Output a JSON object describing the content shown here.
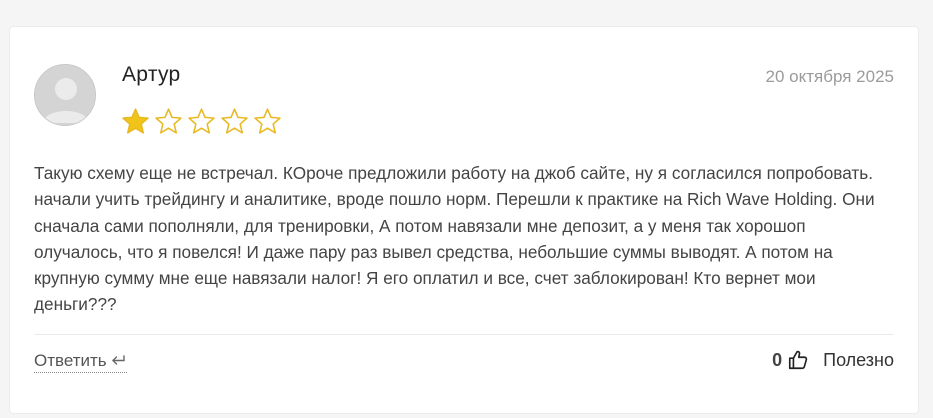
{
  "review": {
    "author": "Артур",
    "date": "20 октября 2025",
    "rating": 1,
    "max_rating": 5,
    "text": "Такую схему еще не встречал. КОроче предложили работу на джоб сайте, ну я согласился попробовать. начали учить трейдингу и аналитике, вроде пошло норм. Перешли к практике на Rich Wave Holding. Они сначала сами пополняли, для тренировки, А потом навязали мне депозит, а у меня так хорошоп олучалось, что я повелся! И даже пару раз вывел средства, небольшие суммы выводят. А потом на крупную сумму мне еще навязали налог! Я его оплатил и все, счет заблокирован! Кто вернет мои деньги???"
  },
  "actions": {
    "reply_label": "Ответить",
    "helpful_count": "0",
    "helpful_label": "Полезно"
  },
  "icons": {
    "star": "star-icon",
    "reply": "reply-arrow-icon",
    "thumb": "thumbs-up-icon",
    "avatar": "user-avatar-icon"
  },
  "colors": {
    "star_filled": "#f0c419",
    "star_outline": "#e8b923",
    "text": "#444444",
    "date": "#9b9b9b"
  }
}
